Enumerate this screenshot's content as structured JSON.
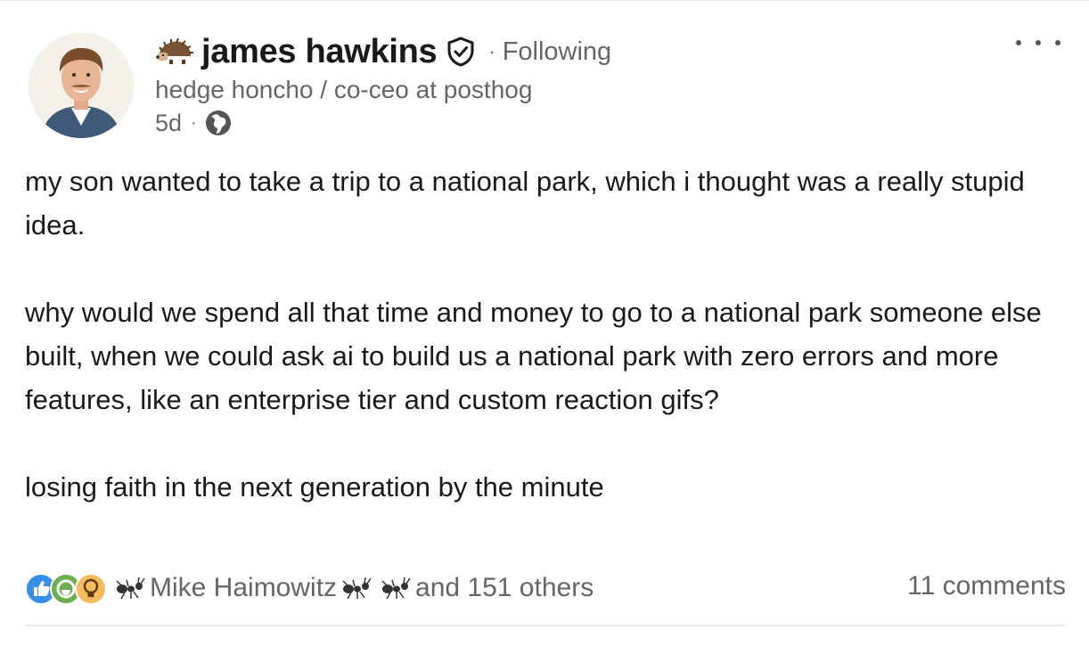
{
  "post": {
    "author": {
      "name": "james hawkins",
      "following_label": "Following",
      "separator": "·",
      "headline": "hedge honcho / co-ceo at posthog",
      "age": "5d",
      "visibility_icon": "globe-icon",
      "prefix_icon": "hedgehog-emoji-icon",
      "badge_icon": "verified-shield-icon"
    },
    "menu_icon": "more-options-icon",
    "body": {
      "p1": "my son wanted to take a trip to a national park, which i thought was a really stupid idea.",
      "p2": "why would we spend all that time and money to go to a national park someone else built, when we could ask ai to build us a national park with zero errors and more features, like an enterprise tier and custom reaction gifs?",
      "p3": "losing faith in the next generation by the minute"
    },
    "social": {
      "reaction_icons": [
        "like-icon",
        "celebrate-icon",
        "insightful-icon"
      ],
      "reactor": "Mike Haimowitz",
      "others": "and 151 others",
      "comments": "11 comments"
    }
  }
}
